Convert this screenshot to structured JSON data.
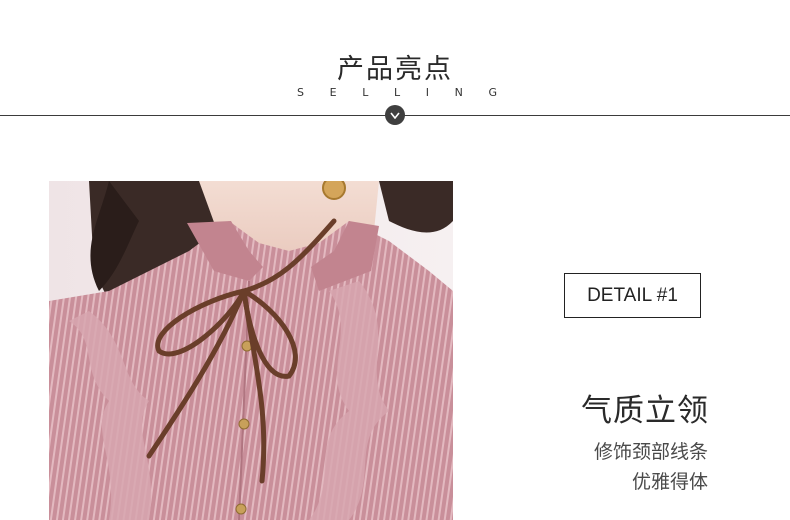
{
  "header": {
    "title": "产品亮点",
    "subtitle_letters": [
      "S",
      "E",
      "L",
      "L",
      "I",
      "N",
      "G"
    ]
  },
  "icons": {
    "chevron": "chevron-down-icon"
  },
  "detail": {
    "label": "DETAIL #1"
  },
  "feature": {
    "title": "气质立领",
    "line1": "修饰颈部线条",
    "line2": "优雅得体"
  },
  "colors": {
    "blouse": "#c98f9a",
    "ribbon": "#6a3e2a",
    "accent": "#3f3f3f"
  }
}
